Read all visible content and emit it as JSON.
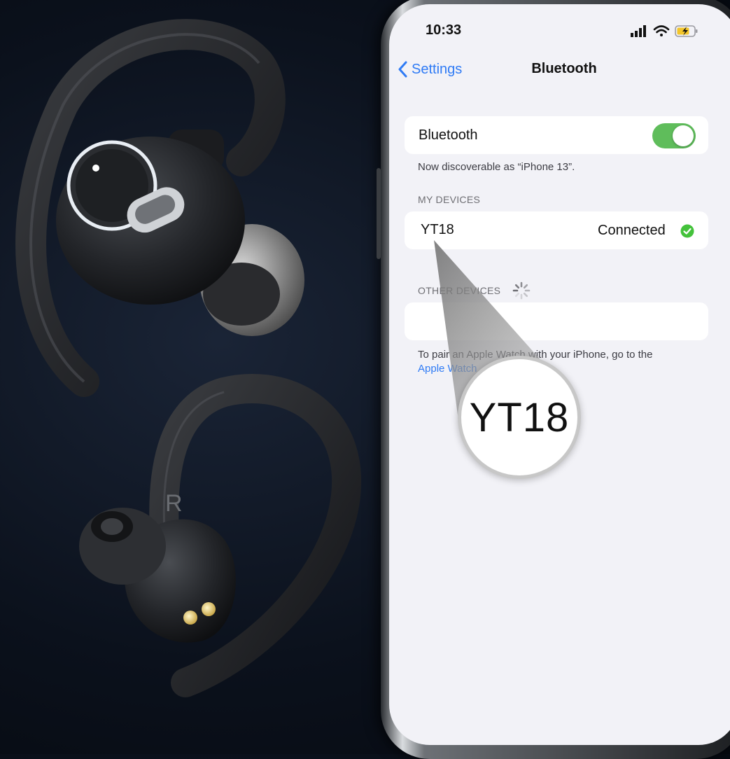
{
  "earbud": {
    "side_marker": "R"
  },
  "status_bar": {
    "time": "10:33"
  },
  "nav": {
    "back_label": "Settings",
    "title": "Bluetooth"
  },
  "bluetooth": {
    "label": "Bluetooth",
    "enabled": true,
    "discoverable_text": "Now discoverable as “iPhone 13”."
  },
  "my_devices": {
    "header": "MY DEVICES",
    "devices": [
      {
        "name": "YT18",
        "status": "Connected"
      }
    ]
  },
  "other_devices": {
    "header": "OTHER DEVICES"
  },
  "footer": {
    "text": "To pair an Apple Watch with your iPhone, go to the",
    "link": "Apple Watch"
  },
  "magnifier": {
    "text": "YT18"
  },
  "colors": {
    "accent": "#2f7bf5",
    "toggle_on": "#5fbd5b",
    "connected_check": "#44c23b"
  }
}
